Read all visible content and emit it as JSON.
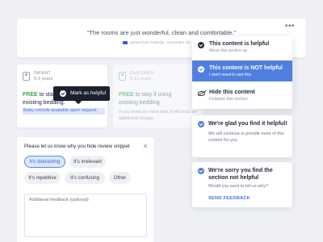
{
  "review": {
    "quote": "“The rooms are just wonderful, clean and comfortable.”",
    "meta": "James from Australia · December 18, 2019",
    "more_icon": "•••"
  },
  "infant": {
    "title": "INFANT",
    "age": "0-2 years",
    "line1_prefix": "FREE",
    "line1_rest": " to stay",
    "line2": "existing bedding.",
    "highlight": "Baby cot/crib available upon request."
  },
  "children": {
    "title": "CHILDREN",
    "age": "3-11 years",
    "line1_prefix": "FREE",
    "line1_rest": " to stay if using",
    "line2": "existing bedding.",
    "note": "If you need an extra bed, it will incur an additional charge."
  },
  "tooltip": {
    "label": "Mark as helpful"
  },
  "feedback": {
    "title": "Please let us know why you hide review snippet",
    "close_icon": "×",
    "chips": [
      "It's distracting",
      "It's irrelevant",
      "It's repetitive",
      "It's confusing",
      "Other"
    ],
    "textarea_placeholder": "Additional feedback (optional)"
  },
  "menu": {
    "items": [
      {
        "title": "This content is helpful",
        "sub": "Move this section up"
      },
      {
        "title": "This content is NOT helpful",
        "sub": "I don't need to see this"
      },
      {
        "title": "Hide this content",
        "sub": "Collapse this section"
      }
    ]
  },
  "glad": {
    "title": "We're glad you find it helpful!",
    "body": "We will continue to provide more of this content for you"
  },
  "sorry": {
    "title": "We're sorry you find the section not helpful",
    "body": "Would you want to tell us why?",
    "action": "SEND FEEDBACK"
  },
  "colors": {
    "accent": "#4f7fe0",
    "free_green": "#3aa65a",
    "dark": "#1c2030"
  }
}
